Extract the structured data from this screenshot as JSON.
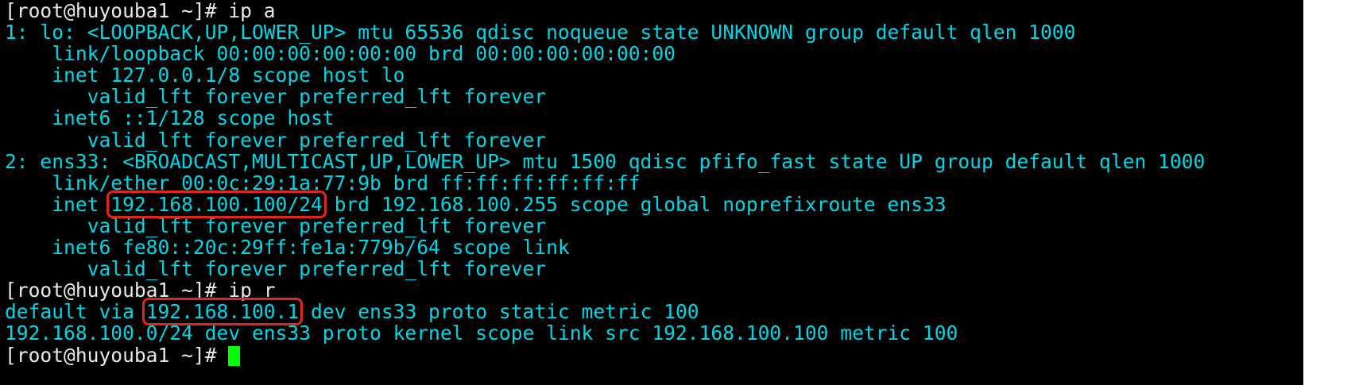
{
  "lines": [
    {
      "parts": [
        {
          "text": "[root@huyouba1 ~]# ip a"
        }
      ]
    },
    {
      "parts": [
        {
          "text": "1: lo: <LOOPBACK,UP,LOWER_UP> mtu 65536 qdisc noqueue state UNKNOWN group default qlen 1000"
        }
      ]
    },
    {
      "parts": [
        {
          "text": "    link/loopback 00:00:00:00:00:00 brd 00:00:00:00:00:00"
        }
      ]
    },
    {
      "parts": [
        {
          "text": "    inet 127.0.0.1/8 scope host lo"
        }
      ]
    },
    {
      "parts": [
        {
          "text": "       valid_lft forever preferred_lft forever"
        }
      ]
    },
    {
      "parts": [
        {
          "text": "    inet6 ::1/128 scope host"
        }
      ]
    },
    {
      "parts": [
        {
          "text": "       valid_lft forever preferred_lft forever"
        }
      ]
    },
    {
      "parts": [
        {
          "text": "2: ens33: <BROADCAST,MULTICAST,UP,LOWER_UP> mtu 1500 qdisc pfifo_fast state UP group default qlen 1000"
        }
      ]
    },
    {
      "parts": [
        {
          "text": "    link/ether 00:0c:29:1a:77:9b brd ff:ff:ff:ff:ff:ff"
        }
      ]
    },
    {
      "parts": [
        {
          "text": "    inet "
        },
        {
          "text": "192.168.100.100/24",
          "highlight": true
        },
        {
          "text": " brd 192.168.100.255 scope global noprefixroute ens33"
        }
      ]
    },
    {
      "parts": [
        {
          "text": "       valid_lft forever preferred_lft forever"
        }
      ]
    },
    {
      "parts": [
        {
          "text": "    inet6 fe80::20c:29ff:fe1a:779b/64 scope link"
        }
      ]
    },
    {
      "parts": [
        {
          "text": "       valid_lft forever preferred_lft forever"
        }
      ]
    },
    {
      "parts": [
        {
          "text": "[root@huyouba1 ~]# ip r"
        }
      ]
    },
    {
      "parts": [
        {
          "text": "default via "
        },
        {
          "text": "192.168.100.1",
          "highlight": true
        },
        {
          "text": " dev ens33 proto static metric 100"
        }
      ]
    },
    {
      "parts": [
        {
          "text": "192.168.100.0/24 dev ens33 proto kernel scope link src 192.168.100.100 metric 100"
        }
      ]
    },
    {
      "parts": [
        {
          "text": "[root@huyouba1 ~]# "
        }
      ],
      "cursor": true
    }
  ],
  "colors": {
    "background": "#000000",
    "text": "#00d7e6",
    "prompt": "#e8e8e8",
    "highlight_box": "#e0261c",
    "cursor": "#00ff00"
  }
}
